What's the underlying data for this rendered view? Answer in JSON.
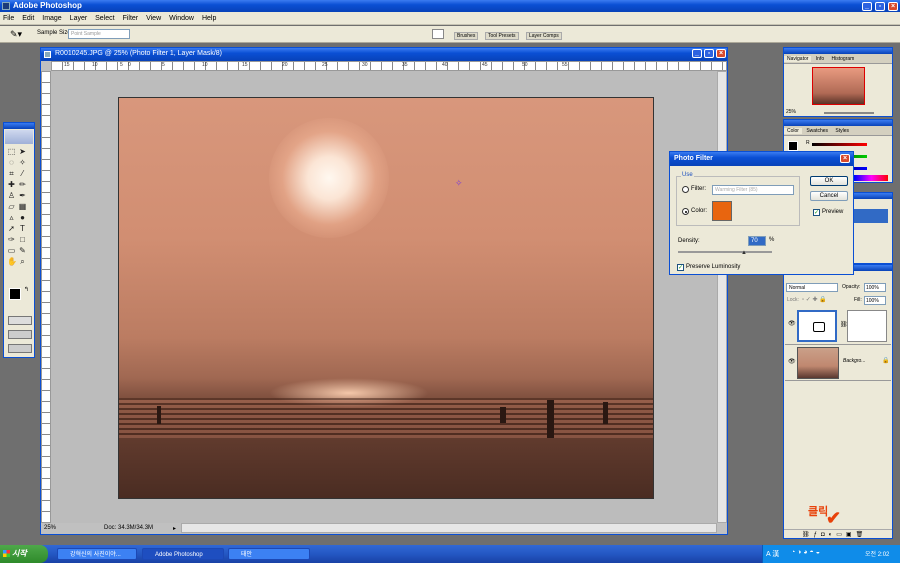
{
  "app": {
    "title": "Adobe Photoshop"
  },
  "menu": [
    "File",
    "Edit",
    "Image",
    "Layer",
    "Select",
    "Filter",
    "View",
    "Window",
    "Help"
  ],
  "options": {
    "sample_size_label": "Sample Size:",
    "sample_size_value": "Point Sample"
  },
  "palette_well": [
    "Brushes",
    "Tool Presets",
    "Layer Comps"
  ],
  "document": {
    "title": "R0010245.JPG @ 25% (Photo Filter 1, Layer Mask/8)",
    "zoom": "25%",
    "doc_info": "Doc: 34.3M/34.3M",
    "ruler_ticks": [
      "15",
      "10",
      "5",
      "0",
      "5",
      "10",
      "15",
      "20",
      "25",
      "30",
      "35",
      "40",
      "45",
      "50",
      "55"
    ]
  },
  "navigator": {
    "tabs": [
      "Navigator",
      "Info",
      "Histogram"
    ],
    "zoom": "25%"
  },
  "color_panel": {
    "tabs": [
      "Color",
      "Swatches",
      "Styles"
    ],
    "channels": [
      "R",
      "G",
      "B"
    ]
  },
  "photo_filter": {
    "title": "Photo Filter",
    "use_label": "Use",
    "filter_label": "Filter:",
    "filter_value": "Warming Filter (85)",
    "color_label": "Color:",
    "filter_color": "#e8650f",
    "ok": "OK",
    "cancel": "Cancel",
    "preview_label": "Preview",
    "density_label": "Density:",
    "density_value": "70",
    "density_unit": "%",
    "preserve_label": "Preserve Luminosity"
  },
  "layers": {
    "blend_mode": "Normal",
    "opacity_label": "Opacity:",
    "opacity_value": "100%",
    "lock_label": "Lock:",
    "fill_label": "Fill:",
    "fill_value": "100%",
    "background_layer": "Backgro..."
  },
  "annotation": {
    "text": "클릭",
    "color": "#e8420a"
  },
  "taskbar": {
    "start": "시작",
    "items": [
      "강혁신의 사진이야...",
      "Adobe Photoshop",
      "태안"
    ],
    "clock": "오전 2:02"
  }
}
